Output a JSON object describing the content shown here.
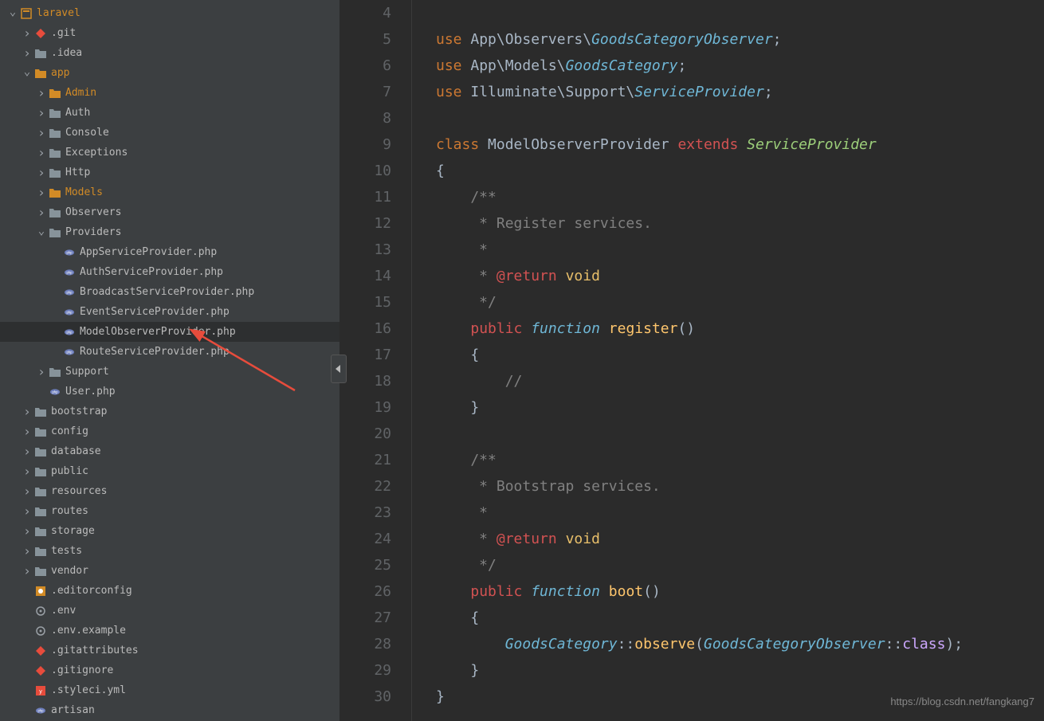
{
  "project": {
    "name": "laravel"
  },
  "tree": [
    {
      "depth": 0,
      "expand": "down",
      "iconType": "project",
      "label": "laravel",
      "orange": true,
      "interact": true
    },
    {
      "depth": 1,
      "expand": "right",
      "iconType": "git",
      "label": ".git",
      "interact": true
    },
    {
      "depth": 1,
      "expand": "right",
      "iconType": "folder-grey",
      "label": ".idea",
      "interact": true
    },
    {
      "depth": 1,
      "expand": "down",
      "iconType": "folder-orange",
      "label": "app",
      "orange": true,
      "interact": true
    },
    {
      "depth": 2,
      "expand": "right",
      "iconType": "folder-orange",
      "label": "Admin",
      "orange": true,
      "interact": true
    },
    {
      "depth": 2,
      "expand": "right",
      "iconType": "folder-grey",
      "label": "Auth",
      "interact": true
    },
    {
      "depth": 2,
      "expand": "right",
      "iconType": "folder-grey",
      "label": "Console",
      "interact": true
    },
    {
      "depth": 2,
      "expand": "right",
      "iconType": "folder-grey",
      "label": "Exceptions",
      "interact": true
    },
    {
      "depth": 2,
      "expand": "right",
      "iconType": "folder-grey",
      "label": "Http",
      "interact": true
    },
    {
      "depth": 2,
      "expand": "right",
      "iconType": "folder-orange",
      "label": "Models",
      "orange": true,
      "interact": true
    },
    {
      "depth": 2,
      "expand": "right",
      "iconType": "folder-grey",
      "label": "Observers",
      "interact": true
    },
    {
      "depth": 2,
      "expand": "down",
      "iconType": "folder-grey",
      "label": "Providers",
      "interact": true
    },
    {
      "depth": 3,
      "expand": "blank",
      "iconType": "php",
      "label": "AppServiceProvider.php",
      "interact": true
    },
    {
      "depth": 3,
      "expand": "blank",
      "iconType": "php",
      "label": "AuthServiceProvider.php",
      "interact": true
    },
    {
      "depth": 3,
      "expand": "blank",
      "iconType": "php",
      "label": "BroadcastServiceProvider.php",
      "interact": true
    },
    {
      "depth": 3,
      "expand": "blank",
      "iconType": "php",
      "label": "EventServiceProvider.php",
      "interact": true
    },
    {
      "depth": 3,
      "expand": "blank",
      "iconType": "php",
      "label": "ModelObserverProvider.php",
      "selected": true,
      "interact": true
    },
    {
      "depth": 3,
      "expand": "blank",
      "iconType": "php",
      "label": "RouteServiceProvider.php",
      "interact": true
    },
    {
      "depth": 2,
      "expand": "right",
      "iconType": "folder-grey",
      "label": "Support",
      "interact": true
    },
    {
      "depth": 2,
      "expand": "blank",
      "iconType": "php",
      "label": "User.php",
      "interact": true
    },
    {
      "depth": 1,
      "expand": "right",
      "iconType": "folder-grey",
      "label": "bootstrap",
      "interact": true
    },
    {
      "depth": 1,
      "expand": "right",
      "iconType": "folder-grey",
      "label": "config",
      "interact": true
    },
    {
      "depth": 1,
      "expand": "right",
      "iconType": "folder-grey",
      "label": "database",
      "interact": true
    },
    {
      "depth": 1,
      "expand": "right",
      "iconType": "folder-grey",
      "label": "public",
      "interact": true
    },
    {
      "depth": 1,
      "expand": "right",
      "iconType": "folder-grey",
      "label": "resources",
      "interact": true
    },
    {
      "depth": 1,
      "expand": "right",
      "iconType": "folder-grey",
      "label": "routes",
      "interact": true
    },
    {
      "depth": 1,
      "expand": "right",
      "iconType": "folder-grey",
      "label": "storage",
      "interact": true
    },
    {
      "depth": 1,
      "expand": "right",
      "iconType": "folder-grey",
      "label": "tests",
      "interact": true
    },
    {
      "depth": 1,
      "expand": "right",
      "iconType": "folder-grey",
      "label": "vendor",
      "interact": true
    },
    {
      "depth": 1,
      "expand": "blank",
      "iconType": "editorconfig",
      "label": ".editorconfig",
      "interact": true
    },
    {
      "depth": 1,
      "expand": "blank",
      "iconType": "gear",
      "label": ".env",
      "interact": true
    },
    {
      "depth": 1,
      "expand": "blank",
      "iconType": "gear",
      "label": ".env.example",
      "interact": true
    },
    {
      "depth": 1,
      "expand": "blank",
      "iconType": "gitfile",
      "label": ".gitattributes",
      "interact": true
    },
    {
      "depth": 1,
      "expand": "blank",
      "iconType": "gitfile",
      "label": ".gitignore",
      "interact": true
    },
    {
      "depth": 1,
      "expand": "blank",
      "iconType": "yml",
      "label": ".styleci.yml",
      "interact": true
    },
    {
      "depth": 1,
      "expand": "blank",
      "iconType": "php",
      "label": "artisan",
      "interact": true
    }
  ],
  "code": {
    "startLine": 4,
    "lines": [
      {
        "tokens": []
      },
      {
        "tokens": [
          {
            "c": "tk-kw",
            "t": "use"
          },
          {
            "c": "tk-plain",
            "t": " App\\Observers\\"
          },
          {
            "c": "tk-cls",
            "t": "GoodsCategoryObserver"
          },
          {
            "c": "tk-punc",
            "t": ";"
          }
        ]
      },
      {
        "tokens": [
          {
            "c": "tk-kw",
            "t": "use"
          },
          {
            "c": "tk-plain",
            "t": " App\\Models\\"
          },
          {
            "c": "tk-cls",
            "t": "GoodsCategory"
          },
          {
            "c": "tk-punc",
            "t": ";"
          }
        ]
      },
      {
        "tokens": [
          {
            "c": "tk-kw",
            "t": "use"
          },
          {
            "c": "tk-plain",
            "t": " Illuminate\\Support\\"
          },
          {
            "c": "tk-cls",
            "t": "ServiceProvider"
          },
          {
            "c": "tk-punc",
            "t": ";"
          }
        ]
      },
      {
        "tokens": []
      },
      {
        "tokens": [
          {
            "c": "tk-kw",
            "t": "class "
          },
          {
            "c": "tk-plain",
            "t": "ModelObserverProvider "
          },
          {
            "c": "tk-tag",
            "t": "extends "
          },
          {
            "c": "tk-cls3",
            "t": "ServiceProvider"
          }
        ]
      },
      {
        "tokens": [
          {
            "c": "tk-punc",
            "t": "{"
          }
        ]
      },
      {
        "tokens": [
          {
            "c": "tk-comment",
            "t": "    /**"
          }
        ]
      },
      {
        "tokens": [
          {
            "c": "tk-comment",
            "t": "     * Register services."
          }
        ]
      },
      {
        "tokens": [
          {
            "c": "tk-comment",
            "t": "     *"
          }
        ]
      },
      {
        "tokens": [
          {
            "c": "tk-comment",
            "t": "     * "
          },
          {
            "c": "tk-tag",
            "t": "@return"
          },
          {
            "c": "tk-comment",
            "t": " "
          },
          {
            "c": "tk-void",
            "t": "void"
          }
        ]
      },
      {
        "tokens": [
          {
            "c": "tk-comment",
            "t": "     */"
          }
        ]
      },
      {
        "tokens": [
          {
            "c": "tk-plain",
            "t": "    "
          },
          {
            "c": "tk-tag",
            "t": "public "
          },
          {
            "c": "tk-cls",
            "t": "function "
          },
          {
            "c": "tk-fn",
            "t": "register"
          },
          {
            "c": "tk-punc",
            "t": "()"
          }
        ]
      },
      {
        "tokens": [
          {
            "c": "tk-punc",
            "t": "    {"
          }
        ]
      },
      {
        "tokens": [
          {
            "c": "tk-comment",
            "t": "        //"
          }
        ]
      },
      {
        "tokens": [
          {
            "c": "tk-punc",
            "t": "    }"
          }
        ]
      },
      {
        "tokens": []
      },
      {
        "tokens": [
          {
            "c": "tk-comment",
            "t": "    /**"
          }
        ]
      },
      {
        "tokens": [
          {
            "c": "tk-comment",
            "t": "     * Bootstrap services."
          }
        ]
      },
      {
        "tokens": [
          {
            "c": "tk-comment",
            "t": "     *"
          }
        ]
      },
      {
        "tokens": [
          {
            "c": "tk-comment",
            "t": "     * "
          },
          {
            "c": "tk-tag",
            "t": "@return"
          },
          {
            "c": "tk-comment",
            "t": " "
          },
          {
            "c": "tk-void",
            "t": "void"
          }
        ]
      },
      {
        "tokens": [
          {
            "c": "tk-comment",
            "t": "     */"
          }
        ]
      },
      {
        "tokens": [
          {
            "c": "tk-plain",
            "t": "    "
          },
          {
            "c": "tk-tag",
            "t": "public "
          },
          {
            "c": "tk-cls",
            "t": "function "
          },
          {
            "c": "tk-fn",
            "t": "boot"
          },
          {
            "c": "tk-punc",
            "t": "()"
          }
        ]
      },
      {
        "tokens": [
          {
            "c": "tk-punc",
            "t": "    {"
          }
        ]
      },
      {
        "tokens": [
          {
            "c": "tk-plain",
            "t": "        "
          },
          {
            "c": "tk-cls",
            "t": "GoodsCategory"
          },
          {
            "c": "tk-op",
            "t": "::"
          },
          {
            "c": "tk-fn",
            "t": "observe"
          },
          {
            "c": "tk-punc",
            "t": "("
          },
          {
            "c": "tk-cls",
            "t": "GoodsCategoryObserver"
          },
          {
            "c": "tk-op",
            "t": "::"
          },
          {
            "c": "tk-static",
            "t": "class"
          },
          {
            "c": "tk-punc",
            "t": ");"
          }
        ]
      },
      {
        "tokens": [
          {
            "c": "tk-punc",
            "t": "    }"
          }
        ]
      },
      {
        "tokens": [
          {
            "c": "tk-punc",
            "t": "}"
          }
        ]
      }
    ]
  },
  "watermark": "https://blog.csdn.net/fangkang7"
}
